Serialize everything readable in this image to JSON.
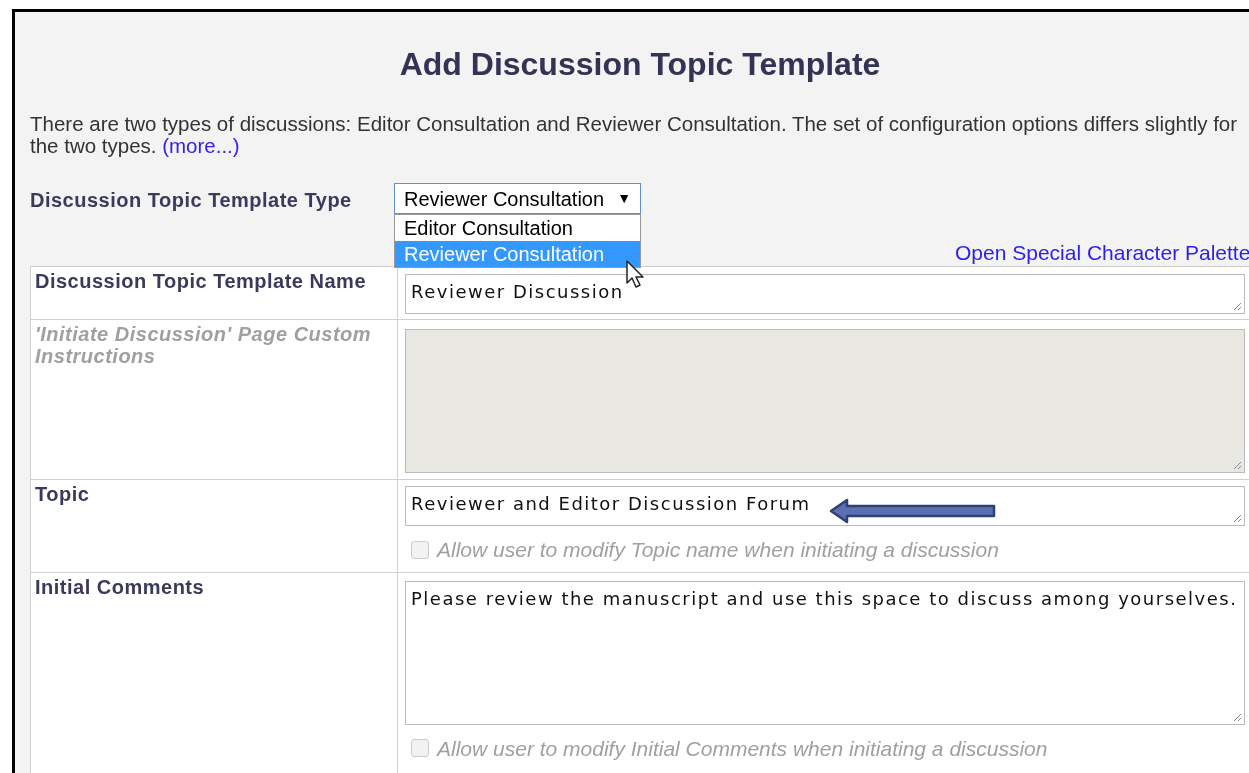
{
  "title": "Add Discussion Topic Template",
  "description": {
    "text": "There are two types of discussions: Editor Consultation and Reviewer Consultation. The set of configuration options differs slightly for the two types.",
    "link": "(more...)"
  },
  "template_type": {
    "label": "Discussion Topic Template Type",
    "value": "Reviewer Consultation",
    "caret": "▼",
    "expanded": true,
    "options": [
      {
        "label": "Editor Consultation",
        "selected": false
      },
      {
        "label": "Reviewer Consultation",
        "selected": true
      }
    ]
  },
  "palette_link": "Open Special Character Palette",
  "fields": [
    {
      "kind": "single",
      "label": "Discussion Topic Template Name",
      "disabled": false,
      "value": "Reviewer Discussion"
    },
    {
      "kind": "multi",
      "label": "'Initiate Discussion' Page Custom Instructions",
      "disabled": true
    },
    {
      "kind": "single",
      "label": "Topic",
      "disabled": false,
      "value": "Reviewer and Editor Discussion Forum",
      "annotated": true,
      "checkbox": {
        "label": "Allow user to modify Topic name when initiating a discussion",
        "checked": false,
        "disabled": true
      }
    },
    {
      "kind": "multi",
      "label": "Initial Comments",
      "disabled": false,
      "value": "Please review the manuscript and use this space to discuss among yourselves.",
      "checkbox": {
        "label": "Allow user to modify Initial Comments when initiating a discussion",
        "checked": false,
        "disabled": true
      }
    }
  ]
}
